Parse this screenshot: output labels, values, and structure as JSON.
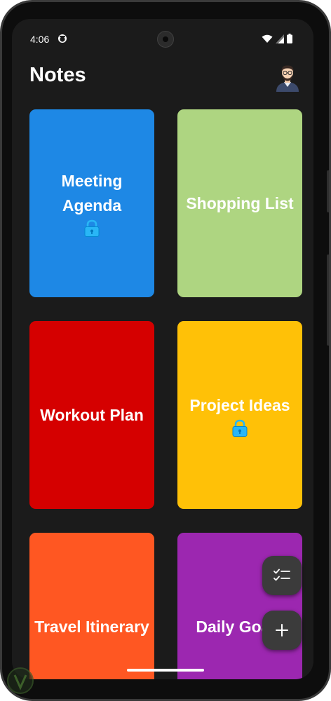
{
  "status_bar": {
    "time": "4:06",
    "icons": [
      "notification-face-icon",
      "wifi-icon",
      "signal-icon",
      "battery-icon"
    ]
  },
  "app": {
    "title": "Notes",
    "avatar": "avatar"
  },
  "notes": [
    {
      "title": "Meeting Agenda",
      "color": "#1e88e5",
      "locked": true
    },
    {
      "title": "Shopping List",
      "color": "#aed581",
      "locked": false
    },
    {
      "title": "Workout Plan",
      "color": "#d50000",
      "locked": false
    },
    {
      "title": "Project Ideas",
      "color": "#ffc107",
      "locked": true
    },
    {
      "title": "Travel Itinerary",
      "color": "#ff5722",
      "locked": false
    },
    {
      "title": "Daily Goals",
      "color": "#9c27b0",
      "locked": false
    }
  ],
  "fabs": {
    "checklist": "checklist-icon",
    "add": "plus-icon"
  },
  "colors": {
    "background": "#1b1b1b",
    "fab": "#3b3b3b",
    "lock": "#29b6f6"
  }
}
